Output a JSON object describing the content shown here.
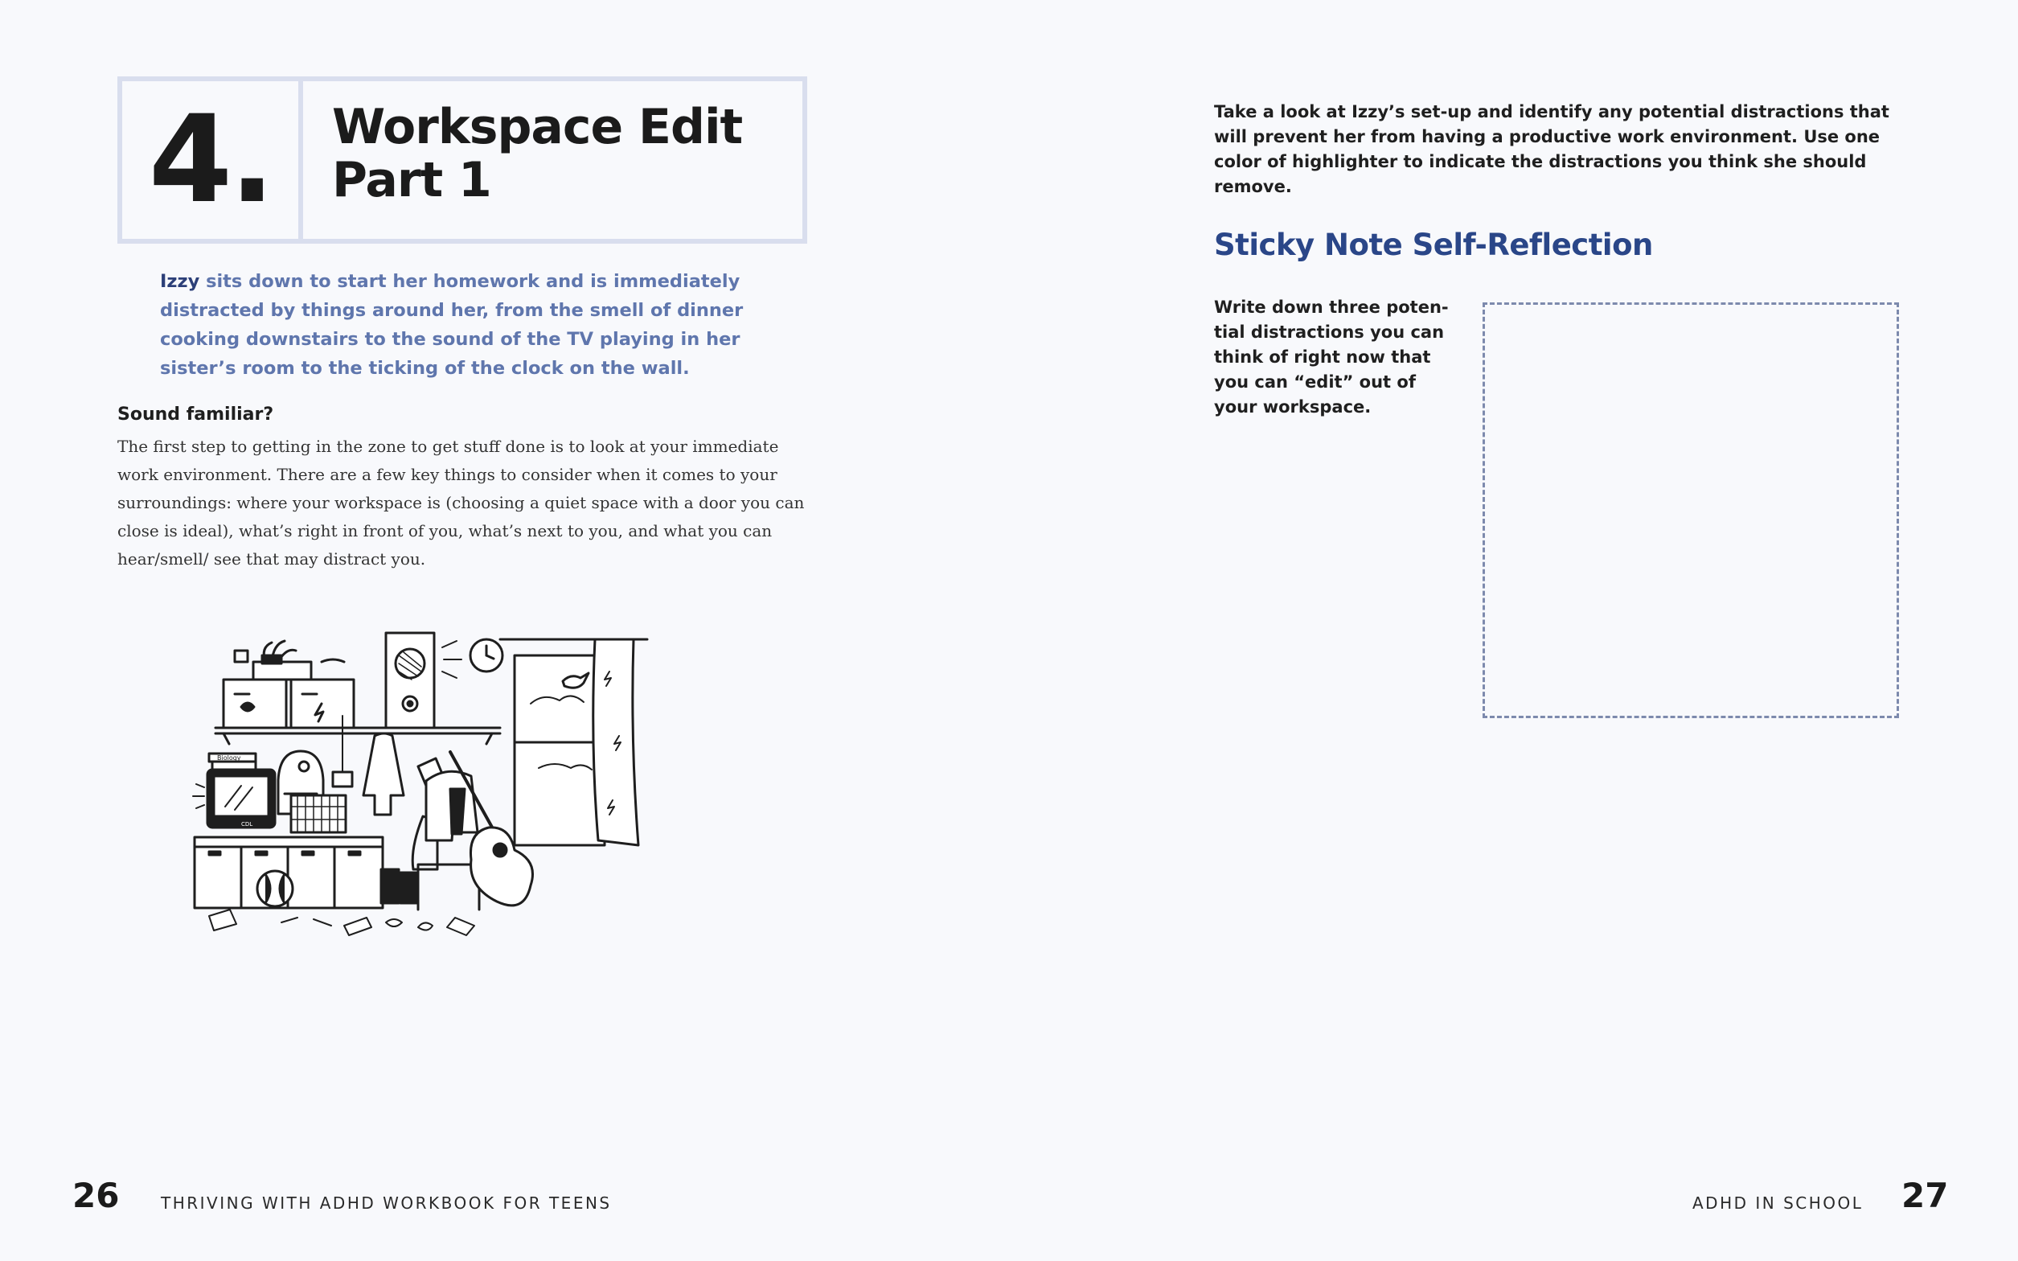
{
  "left_page": {
    "title_number": "4.",
    "title_lines": [
      "Workspace Edit",
      "Part 1"
    ],
    "intro": {
      "name": "Izzy",
      "text": " sits down to start her homework and is immediately distracted by things around her, from the smell of dinner cooking downstairs to the sound of the TV playing in her sister’s room to the ticking of the clock on the wall."
    },
    "sound_heading": "Sound familiar?",
    "body": "The first step to getting in the zone to get stuff done is to look at your immediate work environment. There are a few key things to consider when it comes to your surround­ings: where your workspace is (choosing a quiet space with a door you can close is ideal), what’s right in front of you, what’s next to you, and what you can hear/smell/ see that may distract you.",
    "illustration": {
      "book_label": "Biology",
      "tv_label": "CDL"
    },
    "folio": "26",
    "running_head": "THRIVING WITH ADHD WORKBOOK FOR TEENS"
  },
  "right_page": {
    "instructions": "Take a look at Izzy’s set-up and identify any potential distractions that will prevent her from having a productive work environment. Use one color of highlighter to indicate the distractions you think she should remove.",
    "sticky_heading": "Sticky Note Self-Reflection",
    "sticky_prompt": "Write down three poten­tial distractions you can think of right now that you can “edit” out of your workspace.",
    "folio": "27",
    "running_head": "ADHD IN SCHOOL"
  },
  "colors": {
    "title_border": "#d9deee",
    "intro_text": "#5f76ad",
    "heading_blue": "#2a4688",
    "dashed_border": "#7d8aad"
  }
}
